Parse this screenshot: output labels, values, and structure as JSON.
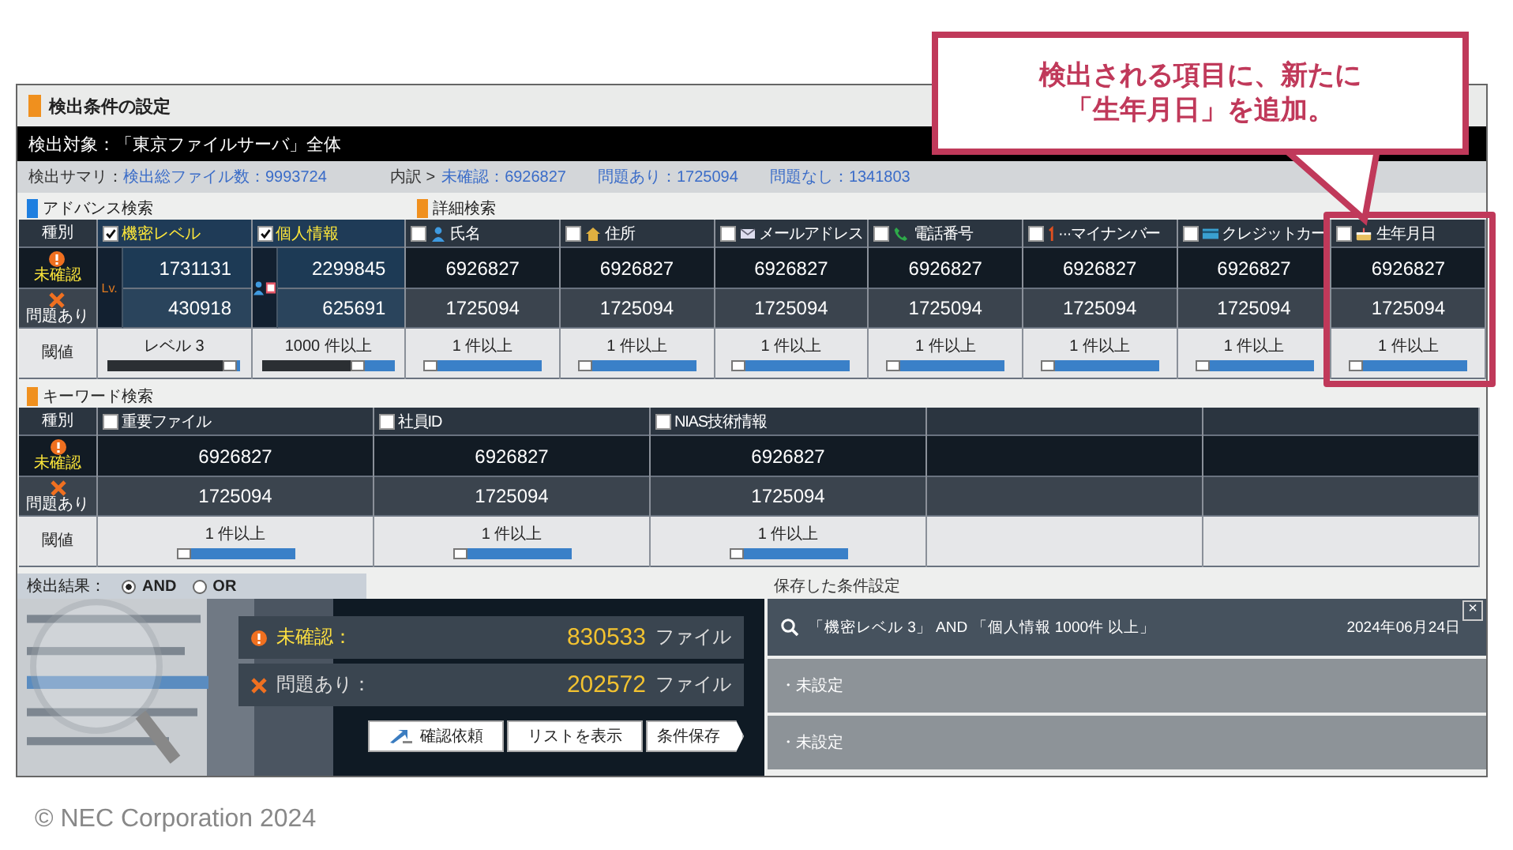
{
  "header": {
    "title": "検出条件の設定"
  },
  "target": "検出対象：「東京ファイルサーバ」全体",
  "summary": {
    "label": "検出サマリ：",
    "total": "検出総ファイル数：9993724",
    "breakdown": "内訳 >",
    "items": [
      "未確認：6926827",
      "問題あり：1725094",
      "問題なし：1341803"
    ]
  },
  "sections": [
    {
      "title": "アドバンス検索",
      "color": "#1e7fe0"
    },
    {
      "title": "詳細検索",
      "color": "#f0901e"
    }
  ],
  "main_table": {
    "row_labels": [
      {
        "kind": "header",
        "text": "種別"
      },
      {
        "kind": "unconfirmed",
        "text": "未確認"
      },
      {
        "kind": "problem",
        "text": "問題あり"
      },
      {
        "kind": "threshold",
        "text": "閾値"
      }
    ],
    "columns": [
      {
        "kind": "level",
        "label": "機密レベル",
        "badge": "Lv.",
        "checked": true,
        "unconfirmed": "1731131",
        "problem": "430918",
        "threshold": "レベル 3",
        "level": 0.97
      },
      {
        "kind": "personal",
        "label": "個人情報",
        "checked": true,
        "unconfirmed": "2299845",
        "problem": "625691",
        "threshold": "1000 件以上",
        "level": 0.75
      },
      {
        "kind": "name",
        "label": "氏名",
        "checked": false,
        "unconfirmed": "6926827",
        "problem": "1725094",
        "threshold": "1 件以上",
        "level": 0
      },
      {
        "kind": "address",
        "label": "住所",
        "checked": false,
        "unconfirmed": "6926827",
        "problem": "1725094",
        "threshold": "1 件以上",
        "level": 0
      },
      {
        "kind": "email",
        "label": "メールアドレス",
        "checked": false,
        "unconfirmed": "6926827",
        "problem": "1725094",
        "threshold": "1 件以上",
        "level": 0
      },
      {
        "kind": "phone",
        "label": "電話番号",
        "checked": false,
        "unconfirmed": "6926827",
        "problem": "1725094",
        "threshold": "1 件以上",
        "level": 0
      },
      {
        "kind": "number",
        "label": "···マイナンバー",
        "checked": false,
        "unconfirmed": "6926827",
        "problem": "1725094",
        "threshold": "1 件以上",
        "level": 0
      },
      {
        "kind": "card",
        "label": "クレジットカー",
        "checked": false,
        "unconfirmed": "6926827",
        "problem": "1725094",
        "threshold": "1 件以上",
        "level": 0
      },
      {
        "kind": "birthday",
        "label": "生年月日",
        "checked": false,
        "unconfirmed": "6926827",
        "problem": "1725094",
        "threshold": "1 件以上",
        "level": 0,
        "highlighted": true
      }
    ]
  },
  "keyword_section": {
    "title": "キーワード検索",
    "color": "#f0901e"
  },
  "keyword_table": {
    "row_labels": [
      {
        "kind": "header",
        "text": "種別"
      },
      {
        "kind": "unconfirmed",
        "text": "未確認"
      },
      {
        "kind": "problem",
        "text": "問題あり"
      },
      {
        "kind": "threshold",
        "text": "閾値"
      }
    ],
    "columns": [
      {
        "label": "重要ファイル",
        "checked": false,
        "unconfirmed": "6926827",
        "problem": "1725094",
        "threshold": "1 件以上",
        "level": 0
      },
      {
        "label": "社員ID",
        "checked": false,
        "unconfirmed": "6926827",
        "problem": "1725094",
        "threshold": "1 件以上",
        "level": 0
      },
      {
        "label": "NIAS技術情報",
        "checked": false,
        "unconfirmed": "6926827",
        "problem": "1725094",
        "threshold": "1 件以上",
        "level": 0
      }
    ]
  },
  "results": {
    "label": "検出結果：",
    "modes": [
      {
        "label": "AND",
        "selected": true
      },
      {
        "label": "OR",
        "selected": false
      }
    ],
    "counts": [
      {
        "kind": "unconfirmed",
        "label": "未確認：",
        "value": "830533",
        "unit": "ファイル"
      },
      {
        "kind": "problem",
        "label": "問題あり：",
        "value": "202572",
        "unit": "ファイル"
      }
    ],
    "buttons": [
      {
        "kind": "request",
        "label": "確認依頼"
      },
      {
        "kind": "plain",
        "label": "リストを表示"
      },
      {
        "kind": "arrow",
        "label": "条件保存"
      }
    ]
  },
  "saved": {
    "title": "保存した条件設定",
    "close": "×",
    "items": [
      {
        "kind": "condition",
        "text": "「機密レベル 3」 AND 「個人情報 1000件 以上」",
        "date": "2024年06月24日"
      },
      {
        "kind": "empty",
        "text": "・未設定"
      },
      {
        "kind": "empty",
        "text": "・未設定"
      }
    ]
  },
  "callout": {
    "lines": [
      "検出される項目に、新たに",
      "「生年月日」を追加。"
    ]
  },
  "footer": "© NEC Corporation 2024"
}
